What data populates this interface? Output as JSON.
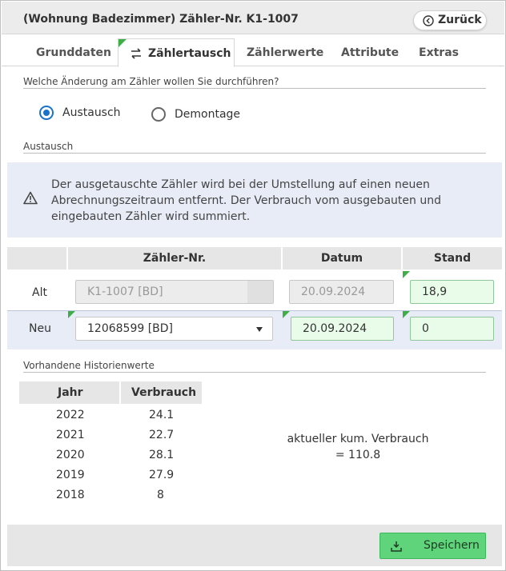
{
  "header": {
    "title": "(Wohnung Badezimmer) Zähler-Nr. K1-1007",
    "back_label": "Zurück"
  },
  "tabs": [
    {
      "label": "Grunddaten",
      "active": false
    },
    {
      "label": "Zählertausch",
      "active": true
    },
    {
      "label": "Zählerwerte",
      "active": false
    },
    {
      "label": "Attribute",
      "active": false
    },
    {
      "label": "Extras",
      "active": false
    }
  ],
  "change": {
    "question": "Welche Änderung am Zähler wollen Sie durchführen?",
    "options": [
      {
        "label": "Austausch",
        "selected": true
      },
      {
        "label": "Demontage",
        "selected": false
      }
    ]
  },
  "austausch": {
    "section_label": "Austausch",
    "notice": "Der ausgetauschte Zähler wird bei der Umstellung auf einen neuen Abrechnungszeitraum entfernt. Der Verbrauch vom ausgebauten und eingebauten Zähler wird summiert.",
    "columns": {
      "number": "Zähler-Nr.",
      "date": "Datum",
      "reading": "Stand"
    },
    "old": {
      "label": "Alt",
      "number": "K1-1007 [BD]",
      "date": "20.09.2024",
      "reading": "18,9"
    },
    "new": {
      "label": "Neu",
      "number": "12068599 [BD]",
      "date": "20.09.2024",
      "reading": "0"
    }
  },
  "history": {
    "section_label": "Vorhandene Historienwerte",
    "columns": {
      "year": "Jahr",
      "consumption": "Verbrauch"
    },
    "rows": [
      {
        "year": "2022",
        "consumption": "24.1"
      },
      {
        "year": "2021",
        "consumption": "22.7"
      },
      {
        "year": "2020",
        "consumption": "28.1"
      },
      {
        "year": "2019",
        "consumption": "27.9"
      },
      {
        "year": "2018",
        "consumption": "8"
      }
    ],
    "kum_label": "aktueller kum. Verbrauch",
    "kum_value": "= 110.8"
  },
  "footer": {
    "save_label": "Speichern"
  },
  "colors": {
    "accent_green": "#5fd47a",
    "radio_blue": "#1a73c9",
    "notice_bg": "#e7ecf7",
    "tab_flag_green": "#3fae49"
  }
}
